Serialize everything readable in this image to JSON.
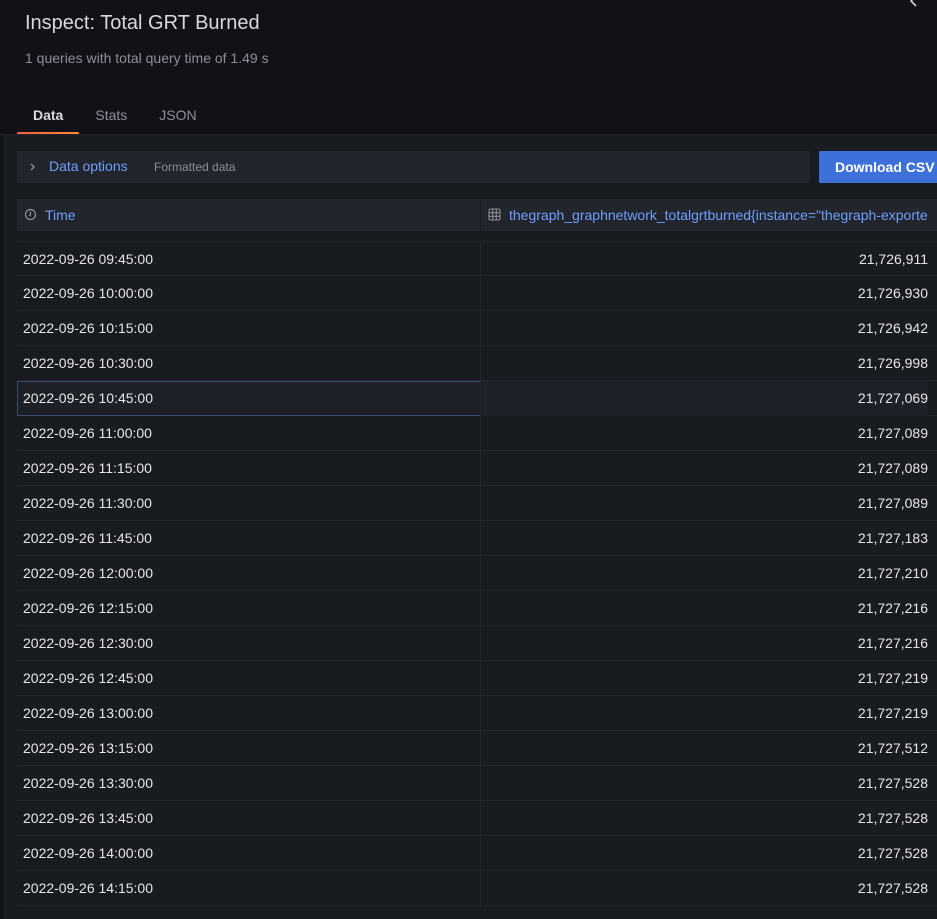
{
  "header": {
    "title": "Inspect: Total GRT Burned",
    "subtitle": "1 queries with total query time of 1.49 s",
    "close_icon": "chevron-left-icon"
  },
  "tabs": [
    {
      "label": "Data",
      "active": true
    },
    {
      "label": "Stats",
      "active": false
    },
    {
      "label": "JSON",
      "active": false
    }
  ],
  "options": {
    "label": "Data options",
    "description": "Formatted data",
    "icon": "chevron-right-icon"
  },
  "download_button": {
    "label": "Download CSV"
  },
  "table": {
    "columns": [
      {
        "label": "Time",
        "icon": "clock-icon"
      },
      {
        "label": "thegraph_graphnetwork_totalgrtburned{instance=\"thegraph-exporte",
        "icon": "grid-icon"
      }
    ],
    "rows": [
      {
        "time": "2022-09-26 09:45:00",
        "value": "21,726,911"
      },
      {
        "time": "2022-09-26 10:00:00",
        "value": "21,726,930"
      },
      {
        "time": "2022-09-26 10:15:00",
        "value": "21,726,942"
      },
      {
        "time": "2022-09-26 10:30:00",
        "value": "21,726,998"
      },
      {
        "time": "2022-09-26 10:45:00",
        "value": "21,727,069"
      },
      {
        "time": "2022-09-26 11:00:00",
        "value": "21,727,089"
      },
      {
        "time": "2022-09-26 11:15:00",
        "value": "21,727,089"
      },
      {
        "time": "2022-09-26 11:30:00",
        "value": "21,727,089"
      },
      {
        "time": "2022-09-26 11:45:00",
        "value": "21,727,183"
      },
      {
        "time": "2022-09-26 12:00:00",
        "value": "21,727,210"
      },
      {
        "time": "2022-09-26 12:15:00",
        "value": "21,727,216"
      },
      {
        "time": "2022-09-26 12:30:00",
        "value": "21,727,216"
      },
      {
        "time": "2022-09-26 12:45:00",
        "value": "21,727,219"
      },
      {
        "time": "2022-09-26 13:00:00",
        "value": "21,727,219"
      },
      {
        "time": "2022-09-26 13:15:00",
        "value": "21,727,512"
      },
      {
        "time": "2022-09-26 13:30:00",
        "value": "21,727,528"
      },
      {
        "time": "2022-09-26 13:45:00",
        "value": "21,727,528"
      },
      {
        "time": "2022-09-26 14:00:00",
        "value": "21,727,528"
      },
      {
        "time": "2022-09-26 14:15:00",
        "value": "21,727,528"
      }
    ],
    "highlighted_row": 4
  },
  "colors": {
    "accent": "#6e9fff",
    "primary_button": "#3d71d9",
    "tab_underline": "#ff7a3d",
    "background": "#181b1f",
    "header_background": "#111217"
  }
}
